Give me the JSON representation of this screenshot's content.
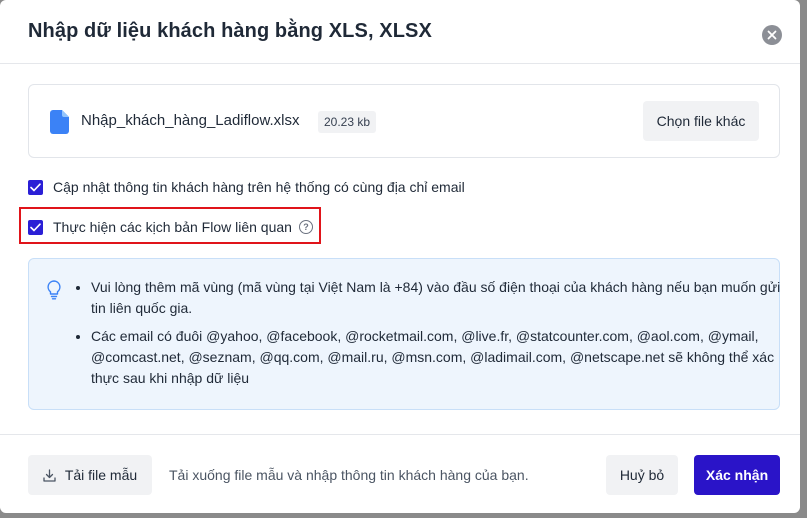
{
  "modal": {
    "title": "Nhập dữ liệu khách hàng bằng XLS, XLSX"
  },
  "file": {
    "name": "Nhập_khách_hàng_Ladiflow.xlsx",
    "size": "20.23 kb",
    "choose_label": "Chọn file khác"
  },
  "options": [
    {
      "label": "Cập nhật thông tin khách hàng trên hệ thống có cùng địa chỉ email",
      "checked": true
    },
    {
      "label": "Thực hiện các kịch bản Flow liên quan",
      "checked": true
    }
  ],
  "info": {
    "items": [
      "Vui lòng thêm mã vùng (mã vùng tại Việt Nam là +84) vào đầu số điện thoại của khách hàng nếu bạn muốn gửi tin liên quốc gia.",
      "Các email có đuôi @yahoo, @facebook, @rocketmail.com, @live.fr, @statcounter.com, @aol.com, @ymail, @comcast.net, @seznam, @qq.com, @mail.ru, @msn.com, @ladimail.com, @netscape.net sẽ không thể xác thực sau khi nhập dữ liệu"
    ]
  },
  "footer": {
    "download_label": "Tải file mẫu",
    "hint": "Tải xuống file mẫu và nhập thông tin khách hàng của bạn.",
    "cancel_label": "Huỷ bỏ",
    "confirm_label": "Xác nhận"
  },
  "colors": {
    "primary": "#2a14c8",
    "checkbox": "#2a1fd6",
    "highlight": "#e0141a",
    "file_icon": "#3b82f6",
    "info_bg": "#eef5fd"
  },
  "icons": {
    "close": "close-icon",
    "file": "file-icon",
    "help": "help-circle-icon",
    "bulb": "lightbulb-icon",
    "download": "download-icon",
    "check": "check-icon"
  }
}
